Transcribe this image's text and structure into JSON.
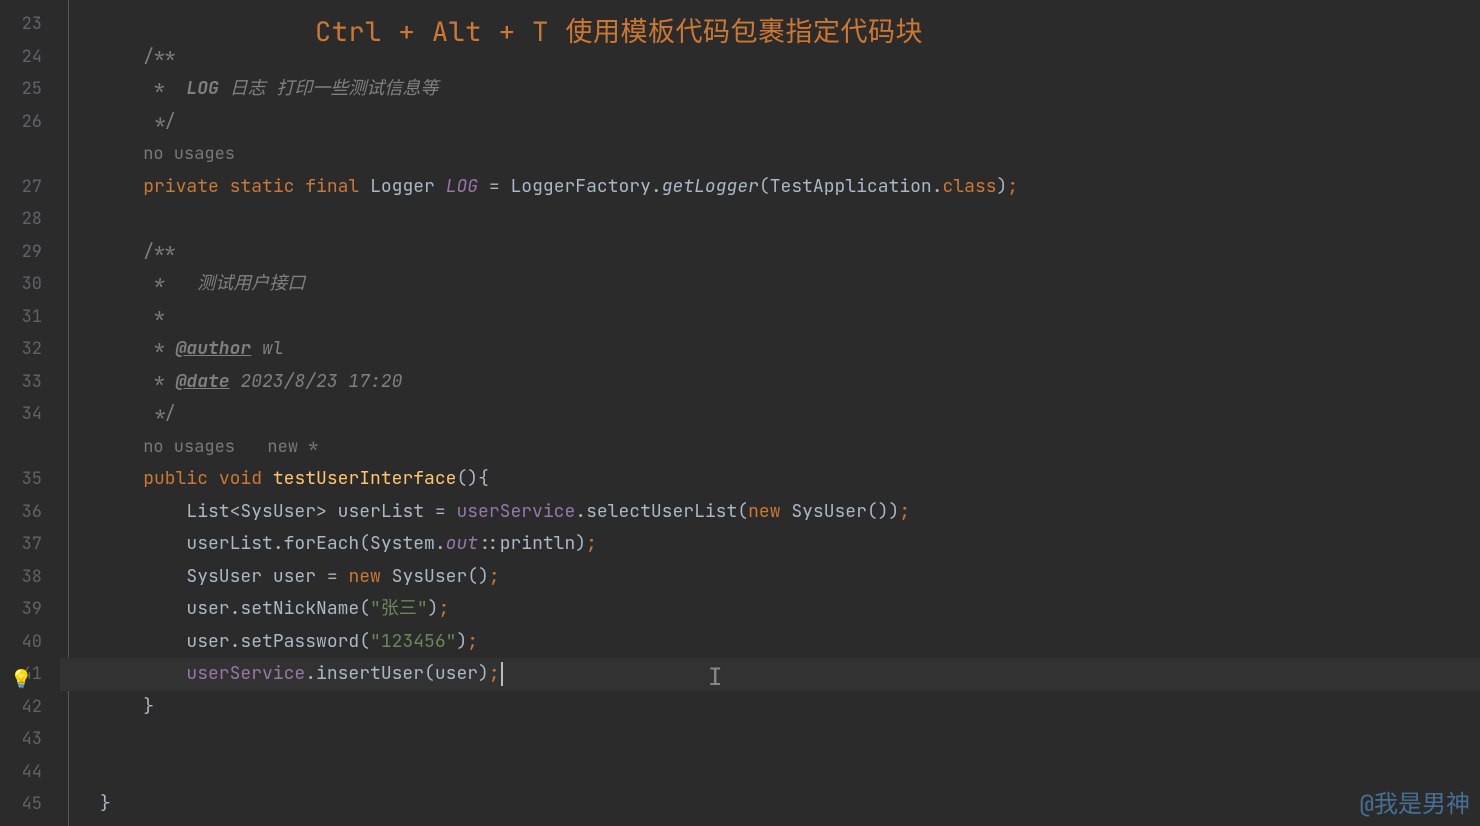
{
  "banner": "Ctrl + Alt + T 使用模板代码包裹指定代码块",
  "watermark": "@我是男神",
  "gutter": {
    "start": 23,
    "lines": [
      "23",
      "24",
      "25",
      "26",
      "",
      "27",
      "28",
      "29",
      "30",
      "31",
      "32",
      "33",
      "34",
      "",
      "35",
      "36",
      "37",
      "38",
      "39",
      "40",
      "41",
      "42",
      "43",
      "44",
      "45"
    ]
  },
  "hints": {
    "noUsages1": "no usages",
    "noUsages2": "no usages",
    "newStar": "new *"
  },
  "code": {
    "l24": "/**",
    "l25_pre": " *  ",
    "l25_log": "LOG",
    "l25_rest": " 日志 打印一些测试信息等",
    "l26": " */",
    "l27_private": "private",
    "l27_static": "static",
    "l27_final": "final",
    "l27_Logger": "Logger",
    "l27_LOG": "LOG",
    "l27_eq": " = ",
    "l27_LoggerFactory": "LoggerFactory",
    "l27_getLogger": "getLogger",
    "l27_TestApp": "TestApplication",
    "l27_class": "class",
    "l29": "/**",
    "l30": " *   测试用户接口",
    "l31": " *",
    "l32_pre": " * ",
    "l32_tag": "@author",
    "l32_val": " wl",
    "l33_pre": " * ",
    "l33_tag": "@date",
    "l33_val": " 2023/8/23 17:20",
    "l34": " */",
    "l35_public": "public",
    "l35_void": "void",
    "l35_method": "testUserInterface",
    "l36_List": "List",
    "l36_SysUser": "SysUser",
    "l36_userList": "userList",
    "l36_userService": "userService",
    "l36_select": "selectUserList",
    "l36_new": "new",
    "l37_forEach": "forEach",
    "l37_System": "System",
    "l37_out": "out",
    "l37_println": "println",
    "l38_SysUser": "SysUser",
    "l38_user": "user",
    "l38_new": "new",
    "l39_setNick": "setNickName",
    "l39_str": "\"张三\"",
    "l40_setPass": "setPassword",
    "l40_str": "\"123456\"",
    "l41_insertUser": "insertUser",
    "l42_brace": "}",
    "l45_brace": "}"
  }
}
